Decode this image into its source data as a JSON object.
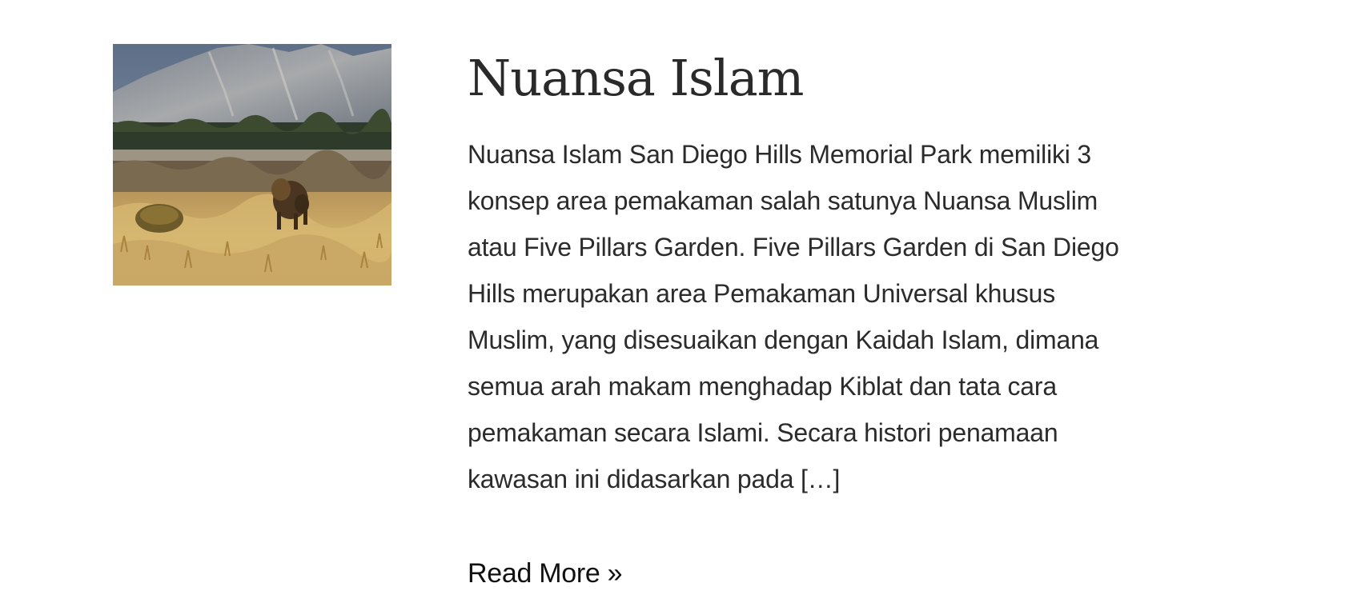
{
  "post": {
    "title": "Nuansa Islam",
    "excerpt_lines": [
      "Nuansa Islam San Diego Hills Memorial Park memiliki 3",
      "konsep area pemakaman salah satunya Nuansa Muslim",
      "atau Five Pillars Garden. Five Pillars Garden di San Diego",
      "Hills merupakan area Pemakaman Universal khusus",
      "Muslim, yang disesuaikan dengan Kaidah Islam, dimana",
      "semua arah makam menghadap Kiblat dan tata cara",
      "pemakaman secara Islami. Secara histori penamaan",
      "kawasan ini didasarkan pada […]"
    ],
    "read_more": "Read More »",
    "thumbnail": {
      "subject": "bison in grassland with mountains and forest",
      "colors": {
        "sky": "#6f7f95",
        "mountain": "#8a8f96",
        "forest": "#2f3b2a",
        "grass": "#c9a65a"
      }
    }
  }
}
